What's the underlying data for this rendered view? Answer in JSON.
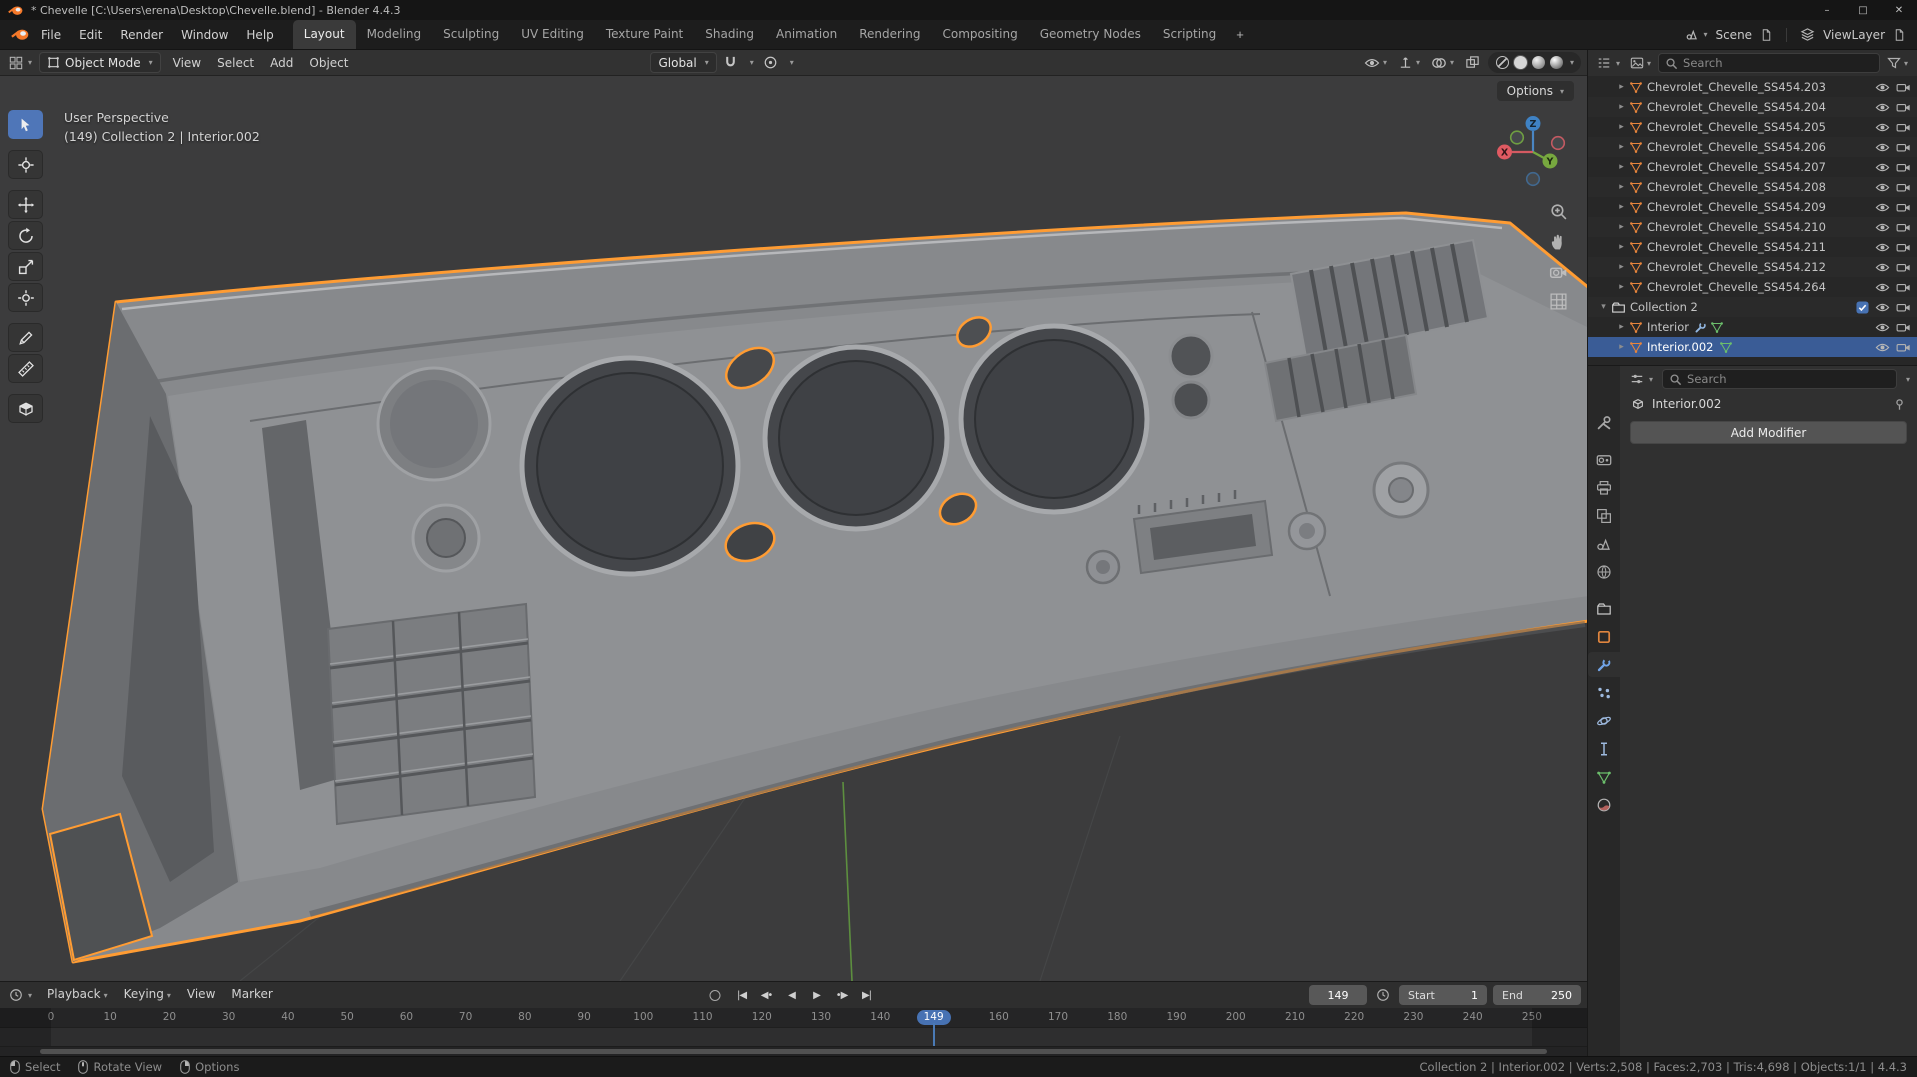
{
  "ui": {
    "chevron_down": "▾",
    "expander_closed": "▸",
    "expander_open": "▾",
    "accent_blue": "#4772b3",
    "selection_orange": "#ff9c33"
  },
  "window": {
    "title": "* Chevelle [C:\\Users\\erena\\Desktop\\Chevelle.blend] - Blender 4.4.3",
    "controls": {
      "minimize": "–",
      "maximize": "□",
      "close": "✕"
    }
  },
  "topbar": {
    "menus": [
      "File",
      "Edit",
      "Render",
      "Window",
      "Help"
    ],
    "workspaces": [
      "Layout",
      "Modeling",
      "Sculpting",
      "UV Editing",
      "Texture Paint",
      "Shading",
      "Animation",
      "Rendering",
      "Compositing",
      "Geometry Nodes",
      "Scripting"
    ],
    "active_workspace": "Layout",
    "add_workspace": "+",
    "scene_name": "Scene",
    "viewlayer_name": "ViewLayer"
  },
  "viewport": {
    "header": {
      "mode": "Object Mode",
      "menus": [
        "View",
        "Select",
        "Add",
        "Object"
      ],
      "orientation": "Global",
      "options": "Options"
    },
    "overlay": {
      "perspective": "User Perspective",
      "context": "(149) Collection 2 | Interior.002"
    },
    "gizmo_axes": [
      "X",
      "Y",
      "Z"
    ]
  },
  "toolbar": {
    "active": "select-box",
    "tools": [
      {
        "name": "select-box"
      },
      {
        "name": "cursor"
      },
      {
        "name": "move"
      },
      {
        "name": "rotate"
      },
      {
        "name": "scale"
      },
      {
        "name": "transform"
      },
      {
        "name": "annotate"
      },
      {
        "name": "measure"
      },
      {
        "name": "add-cube"
      }
    ]
  },
  "outliner": {
    "search_placeholder": "Search",
    "items": [
      {
        "label": "Chevrolet_Chevelle_SS454.203",
        "type": "mesh"
      },
      {
        "label": "Chevrolet_Chevelle_SS454.204",
        "type": "mesh"
      },
      {
        "label": "Chevrolet_Chevelle_SS454.205",
        "type": "mesh"
      },
      {
        "label": "Chevrolet_Chevelle_SS454.206",
        "type": "mesh"
      },
      {
        "label": "Chevrolet_Chevelle_SS454.207",
        "type": "mesh"
      },
      {
        "label": "Chevrolet_Chevelle_SS454.208",
        "type": "mesh"
      },
      {
        "label": "Chevrolet_Chevelle_SS454.209",
        "type": "mesh"
      },
      {
        "label": "Chevrolet_Chevelle_SS454.210",
        "type": "mesh"
      },
      {
        "label": "Chevrolet_Chevelle_SS454.211",
        "type": "mesh"
      },
      {
        "label": "Chevrolet_Chevelle_SS454.212",
        "type": "mesh"
      },
      {
        "label": "Chevrolet_Chevelle_SS454.264",
        "type": "mesh"
      },
      {
        "label": "Collection 2",
        "type": "collection",
        "checkbox": true
      },
      {
        "label": "Interior",
        "type": "mesh",
        "extra": [
          "modifiers",
          "mesh-data"
        ]
      },
      {
        "label": "Interior.002",
        "type": "mesh",
        "selected": true,
        "extra": [
          "mesh-data"
        ]
      }
    ]
  },
  "properties": {
    "search_placeholder": "Search",
    "breadcrumb_object": "Interior.002",
    "add_modifier": "Add Modifier",
    "tabs": [
      {
        "name": "tool"
      },
      {
        "name": "render"
      },
      {
        "name": "output"
      },
      {
        "name": "view-layer"
      },
      {
        "name": "scene"
      },
      {
        "name": "world"
      },
      {
        "name": "collection"
      },
      {
        "name": "object"
      },
      {
        "name": "modifiers",
        "active": true
      },
      {
        "name": "particles"
      },
      {
        "name": "physics"
      },
      {
        "name": "constraints"
      },
      {
        "name": "object-data"
      },
      {
        "name": "material"
      }
    ]
  },
  "timeline": {
    "menus": [
      "Playback",
      "Keying",
      "View",
      "Marker"
    ],
    "transport": [
      {
        "name": "jump-to-start",
        "glyph": "|◀"
      },
      {
        "name": "previous-keyframe",
        "glyph": "◀•"
      },
      {
        "name": "play-reverse",
        "glyph": "◀"
      },
      {
        "name": "play",
        "glyph": "▶"
      },
      {
        "name": "next-keyframe",
        "glyph": "•▶"
      },
      {
        "name": "jump-to-end",
        "glyph": "▶|"
      }
    ],
    "current_frame": "149",
    "start_label": "Start",
    "start_value": "1",
    "end_label": "End",
    "end_value": "250",
    "frame_min": 0,
    "frame_max": 250,
    "ticks": [
      0,
      10,
      20,
      30,
      40,
      50,
      60,
      70,
      80,
      90,
      100,
      110,
      120,
      130,
      140,
      160,
      170,
      180,
      190,
      200,
      210,
      220,
      230,
      240,
      250
    ]
  },
  "statusbar": {
    "hints": [
      {
        "label": "Select",
        "button": "left"
      },
      {
        "label": "Rotate View",
        "button": "middle"
      },
      {
        "label": "Options",
        "button": "right"
      }
    ],
    "stats": "Collection 2 | Interior.002 | Verts:2,508 | Faces:2,703 | Tris:4,698 | Objects:1/1 | 4.4.3"
  }
}
